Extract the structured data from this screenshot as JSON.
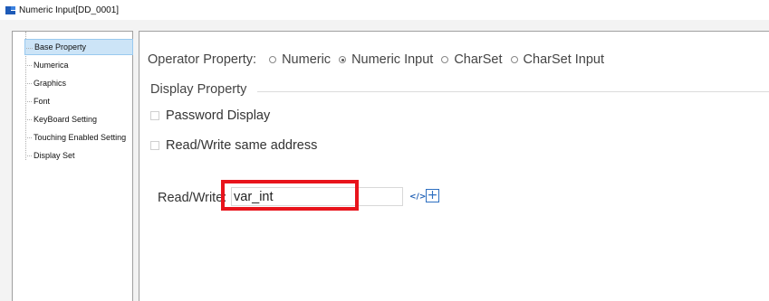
{
  "window": {
    "title": "Numeric Input[DD_0001]",
    "icon": "app-icon"
  },
  "tree": {
    "items": [
      {
        "label": "Base Property",
        "selected": true
      },
      {
        "label": "Numerica",
        "selected": false
      },
      {
        "label": "Graphics",
        "selected": false
      },
      {
        "label": "Font",
        "selected": false
      },
      {
        "label": "KeyBoard Setting",
        "selected": false
      },
      {
        "label": "Touching Enabled Setting",
        "selected": false
      },
      {
        "label": "Display Set",
        "selected": false
      }
    ]
  },
  "operator": {
    "label": "Operator Property:",
    "options": [
      {
        "label": "Numeric",
        "checked": false
      },
      {
        "label": "Numeric Input",
        "checked": true
      },
      {
        "label": "CharSet",
        "checked": false
      },
      {
        "label": "CharSet Input",
        "checked": false
      }
    ]
  },
  "display": {
    "group_title": "Display Property",
    "password_label": "Password Display",
    "password_checked": false,
    "same_address_label": "Read/Write same address",
    "same_address_checked": false
  },
  "readwrite": {
    "label": "Read/Write:",
    "value": "var_int",
    "code_icon": "code-icon",
    "add_icon": "plus-icon"
  },
  "colors": {
    "highlight": "#e8141c",
    "accent": "#2d6fc1",
    "selection": "#cce4f7"
  }
}
